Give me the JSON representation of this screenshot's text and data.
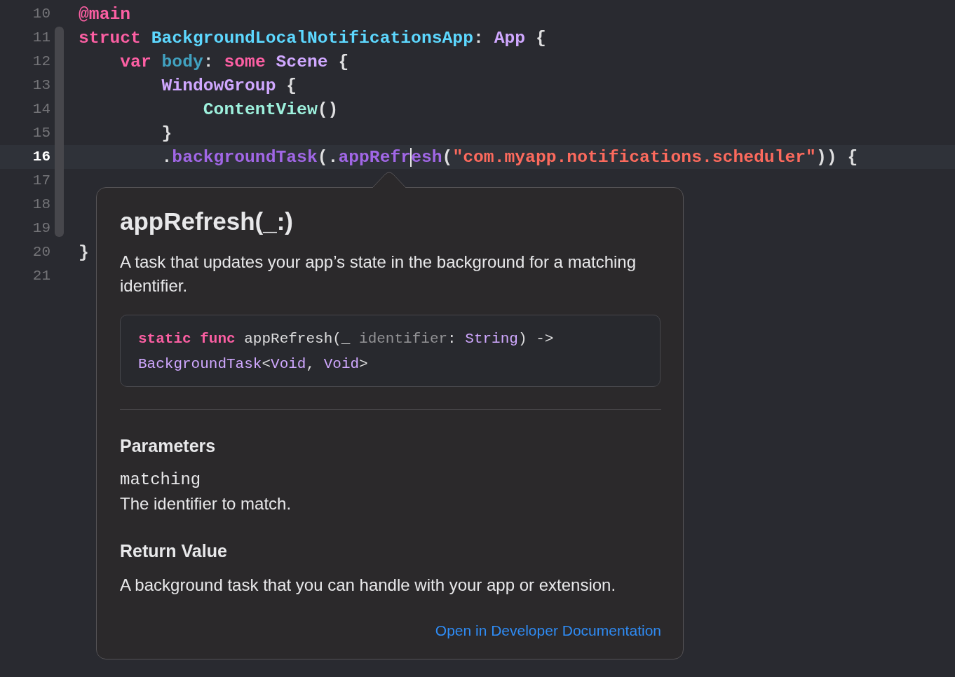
{
  "editor": {
    "lines": [
      {
        "number": "10",
        "current": false,
        "tokens": [
          {
            "text": "@main",
            "kind": "attribute"
          }
        ]
      },
      {
        "number": "11",
        "current": false,
        "tokens": [
          {
            "text": "struct ",
            "kind": "keyword"
          },
          {
            "text": "BackgroundLocalNotificationsApp",
            "kind": "declaration"
          },
          {
            "text": ": ",
            "kind": "plain"
          },
          {
            "text": "App",
            "kind": "type"
          },
          {
            "text": " {",
            "kind": "plain"
          }
        ]
      },
      {
        "number": "12",
        "current": false,
        "tokens": [
          {
            "text": "    var ",
            "kind": "keyword"
          },
          {
            "text": "body",
            "kind": "property"
          },
          {
            "text": ": ",
            "kind": "plain"
          },
          {
            "text": "some ",
            "kind": "keyword"
          },
          {
            "text": "Scene",
            "kind": "type"
          },
          {
            "text": " {",
            "kind": "plain"
          }
        ]
      },
      {
        "number": "13",
        "current": false,
        "tokens": [
          {
            "text": "        WindowGroup",
            "kind": "type"
          },
          {
            "text": " {",
            "kind": "plain"
          }
        ]
      },
      {
        "number": "14",
        "current": false,
        "tokens": [
          {
            "text": "            ContentView",
            "kind": "project"
          },
          {
            "text": "()",
            "kind": "plain"
          }
        ]
      },
      {
        "number": "15",
        "current": false,
        "tokens": [
          {
            "text": "        }",
            "kind": "plain"
          }
        ]
      },
      {
        "number": "16",
        "current": true,
        "tokens": [
          {
            "text": "        .",
            "kind": "plain"
          },
          {
            "text": "backgroundTask",
            "kind": "method"
          },
          {
            "text": "(.",
            "kind": "plain"
          },
          {
            "text": "appRefr",
            "kind": "method"
          },
          {
            "kind": "caret"
          },
          {
            "text": "esh",
            "kind": "method"
          },
          {
            "text": "(",
            "kind": "plain"
          },
          {
            "text": "\"com.myapp.notifications.scheduler\"",
            "kind": "string"
          },
          {
            "text": ")) {",
            "kind": "plain"
          }
        ]
      },
      {
        "number": "17",
        "current": false
      },
      {
        "number": "18",
        "current": false
      },
      {
        "number": "19",
        "current": false
      },
      {
        "number": "20",
        "current": false,
        "tokens": [
          {
            "text": "}",
            "kind": "plain"
          }
        ]
      },
      {
        "number": "21",
        "current": false
      }
    ]
  },
  "popover": {
    "title": "appRefresh(_:)",
    "summary": "A task that updates your app’s state in the background for a matching identifier.",
    "declaration": [
      {
        "text": "static func",
        "kind": "keyword"
      },
      {
        "text": " appRefresh(_ ",
        "kind": "plain"
      },
      {
        "text": "identifier",
        "kind": "param"
      },
      {
        "text": ": ",
        "kind": "plain"
      },
      {
        "text": "String",
        "kind": "type"
      },
      {
        "text": ") -> ",
        "kind": "plain"
      },
      {
        "text": "BackgroundTask",
        "kind": "type"
      },
      {
        "text": "<",
        "kind": "plain"
      },
      {
        "text": "Void",
        "kind": "type"
      },
      {
        "text": ", ",
        "kind": "plain"
      },
      {
        "text": "Void",
        "kind": "type"
      },
      {
        "text": ">",
        "kind": "plain"
      }
    ],
    "parameters_heading": "Parameters",
    "parameters": [
      {
        "name": "matching",
        "description": "The identifier to match."
      }
    ],
    "return_heading": "Return Value",
    "return_text": "A background task that you can handle with your app or extension.",
    "link": "Open in Developer Documentation"
  }
}
